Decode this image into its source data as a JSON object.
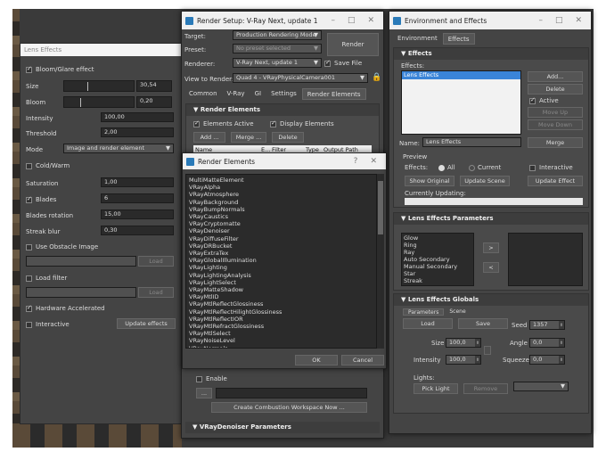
{
  "lens_panel": {
    "title": "Lens Effects",
    "bloom_label": "Bloom/Glare effect",
    "rows": [
      {
        "label": "Size",
        "value": "30,54"
      },
      {
        "label": "Bloom",
        "value": "0,20"
      },
      {
        "label": "Intensity",
        "value": "100,00"
      },
      {
        "label": "Threshold",
        "value": "2,00"
      }
    ],
    "mode_label": "Mode",
    "mode_value": "Image and render element",
    "cold_warm": "Cold/Warm",
    "saturation_label": "Saturation",
    "saturation_value": "1,00",
    "blades_label": "Blades",
    "blades_value": "6",
    "blades_rotation_label": "Blades rotation",
    "blades_rotation_value": "15,00",
    "streak_blur_label": "Streak blur",
    "streak_blur_value": "0,30",
    "use_obstacle": "Use Obstacle Image",
    "load1": "Load",
    "load_filter": "Load filter",
    "load2": "Load",
    "hardware": "Hardware Accelerated",
    "interactive": "Interactive",
    "update_effects": "Update effects"
  },
  "render_setup": {
    "title": "Render Setup: V-Ray Next, update 1",
    "target_label": "Target:",
    "target_value": "Production Rendering Mode",
    "preset_label": "Preset:",
    "preset_value": "No preset selected",
    "renderer_label": "Renderer:",
    "renderer_value": "V-Ray Next, update 1",
    "save_file": "Save File",
    "view_label": "View to Render:",
    "view_value": "Quad 4 - VRayPhysicalCamera001",
    "render_btn": "Render",
    "tabs": [
      "Common",
      "V-Ray",
      "GI",
      "Settings",
      "Render Elements"
    ],
    "re_header": "Render Elements",
    "elements_active": "Elements Active",
    "display_elements": "Display Elements",
    "add": "Add ...",
    "merge": "Merge ...",
    "delete": "Delete",
    "col_name": "Name",
    "col_e": "E...",
    "col_filter": "Filter",
    "col_type": "Type",
    "col_output": "Output Path",
    "enable": "Enable",
    "ellipsis": "...",
    "create_combustion": "Create Combustion Workspace Now ...",
    "denoiser_header": "VRayDenoiser Parameters"
  },
  "render_elements": {
    "title": "Render Elements",
    "help": "?",
    "items": [
      "MultiMatteElement",
      "VRayAlpha",
      "VRayAtmosphere",
      "VRayBackground",
      "VRayBumpNormals",
      "VRayCaustics",
      "VRayCryptomatte",
      "VRayDenoiser",
      "VRayDiffuseFilter",
      "VRayDRBucket",
      "VRayExtraTex",
      "VRayGlobalIllumination",
      "VRayLighting",
      "VRayLightingAnalysis",
      "VRayLightSelect",
      "VRayMatteShadow",
      "VRayMtlID",
      "VRayMtlReflectGlossiness",
      "VRayMtlReflectHilightGlossiness",
      "VRayMtlReflectIOR",
      "VRayMtlRefractGlossiness",
      "VRayMtlSelect",
      "VRayNoiseLevel",
      "VRayNormals"
    ],
    "ok": "OK",
    "cancel": "Cancel"
  },
  "env": {
    "title": "Environment and Effects",
    "tabs": [
      "Environment",
      "Effects"
    ],
    "effects_header": "Effects",
    "effects_label": "Effects:",
    "effects_items": [
      "Lens Effects"
    ],
    "add": "Add...",
    "delete": "Delete",
    "active": "Active",
    "move_up": "Move Up",
    "move_down": "Move Down",
    "name_label": "Name:",
    "name_value": "Lens Effects",
    "merge": "Merge",
    "preview_label": "Preview",
    "effects_preview": "Effects:",
    "all": "All",
    "current": "Current",
    "interactive": "Interactive",
    "show_original": "Show Original",
    "update_scene": "Update Scene",
    "update_effect": "Update Effect",
    "currently_updating": "Currently Updating:",
    "lens_params_header": "Lens Effects Parameters",
    "lens_list": [
      "Glow",
      "Ring",
      "Ray",
      "Auto Secondary",
      "Manual Secondary",
      "Star",
      "Streak"
    ],
    "move_right": ">",
    "move_left": "<",
    "globals_header": "Lens Effects Globals",
    "global_tabs": [
      "Parameters",
      "Scene"
    ],
    "load": "Load",
    "save": "Save",
    "seed_label": "Seed",
    "seed_value": "1357",
    "size_label": "Size",
    "size_value": "100,0",
    "angle_label": "Angle",
    "angle_value": "0,0",
    "intensity_label": "Intensity",
    "intensity_value": "100,0",
    "squeeze_label": "Squeeze",
    "squeeze_value": "0,0",
    "lights_label": "Lights:",
    "pick_light": "Pick Light",
    "remove": "Remove"
  }
}
